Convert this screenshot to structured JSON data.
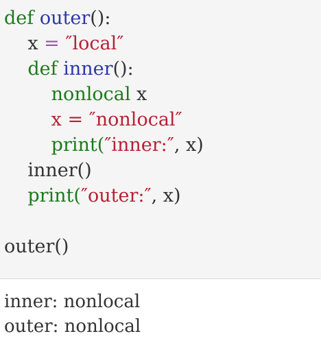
{
  "code": {
    "line1": {
      "def": "def",
      "name": "outer",
      "rest": "():"
    },
    "line2": {
      "indent": "    ",
      "var": "x",
      "op": " = ",
      "value": "″local″"
    },
    "line3": {
      "indent": "    ",
      "def": "def",
      "name": "inner",
      "rest": "():"
    },
    "line4": {
      "indent": "        ",
      "keyword": "nonlocal",
      "rest": " x"
    },
    "line5": {
      "indent": "        ",
      "text": "x = ″nonlocal″"
    },
    "line6": {
      "indent": "        ",
      "call": "print(",
      "string": "″inner:″",
      "rest": ", x)"
    },
    "line7": {
      "indent": "    ",
      "text": "inner()"
    },
    "line8": {
      "indent": "    ",
      "call": "print(",
      "string": "″outer:″",
      "rest": ", x)"
    },
    "line10": {
      "text": "outer()"
    }
  },
  "output": {
    "line1": "inner: nonlocal",
    "line2": "outer: nonlocal"
  },
  "colors": {
    "keyword": "#1b7a1b",
    "function_name": "#2b38a8",
    "string": "#b82036",
    "operator": "#a34bb3",
    "code_background": "#f5f5f5",
    "output_background": "#ffffff"
  }
}
